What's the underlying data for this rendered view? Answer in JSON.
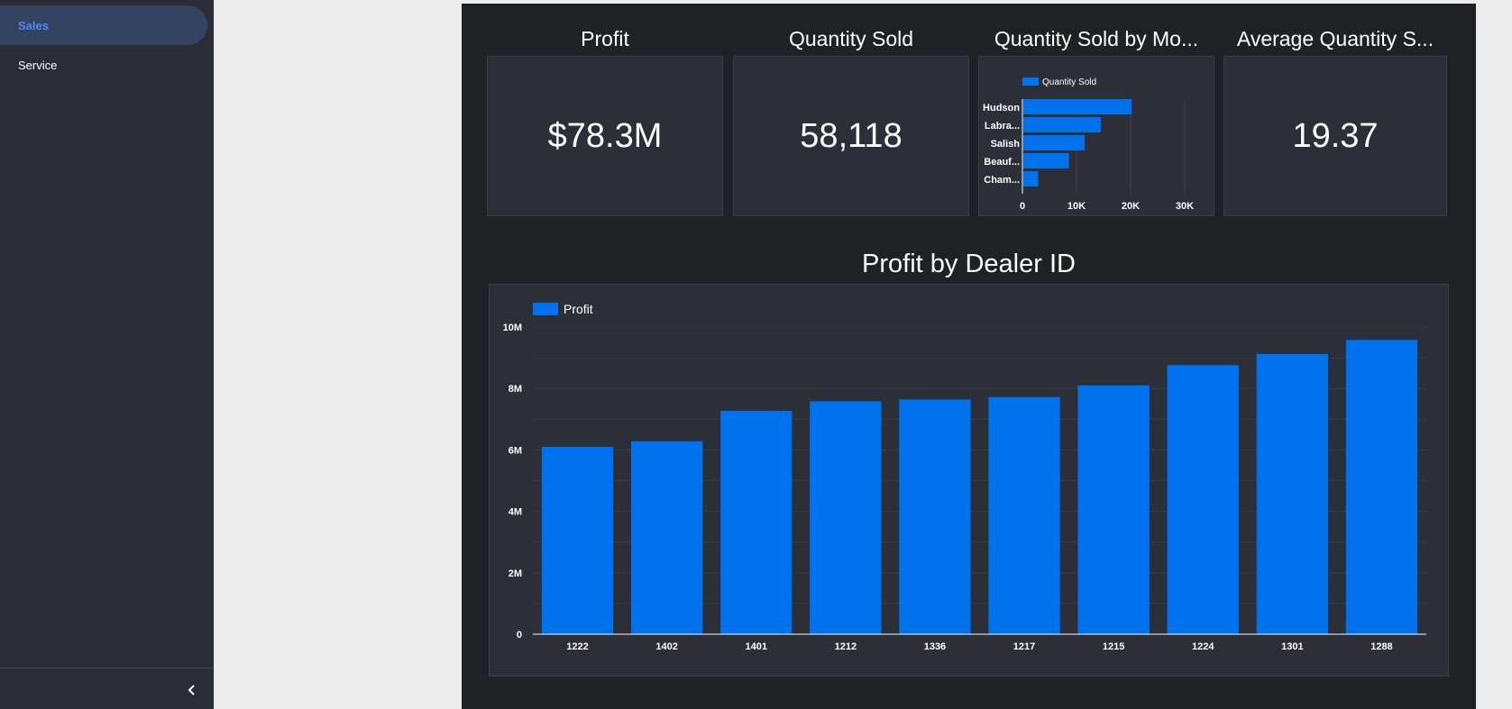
{
  "sidebar": {
    "items": [
      {
        "label": "Sales",
        "active": true
      },
      {
        "label": "Service",
        "active": false
      }
    ],
    "collapse_icon": "chevron-left-icon"
  },
  "theme": {
    "canvas_bg": "#202124",
    "card_bg": "#2d2f38",
    "bar_color": "#0072ee",
    "active_nav_color": "#4c8bf5"
  },
  "kpis": {
    "profit": {
      "title": "Profit",
      "value": "$78.3M"
    },
    "quantity_sold": {
      "title": "Quantity Sold",
      "value": "58,118"
    },
    "avg_quantity": {
      "title": "Average Quantity S...",
      "value": "19.37"
    }
  },
  "model_chart": {
    "title": "Quantity Sold by Mo...",
    "legend": "Quantity Sold",
    "categories": [
      "Hudson",
      "Labra...",
      "Salish",
      "Beauf...",
      "Cham..."
    ],
    "values": [
      20200,
      14500,
      11500,
      8600,
      2900
    ],
    "ticks": [
      {
        "v": 0,
        "label": "0"
      },
      {
        "v": 10000,
        "label": "10K"
      },
      {
        "v": 20000,
        "label": "20K"
      },
      {
        "v": 30000,
        "label": "30K"
      }
    ],
    "xlim": [
      0,
      32000
    ]
  },
  "dealer_chart": {
    "title": "Profit by Dealer ID",
    "legend": "Profit",
    "categories": [
      "1222",
      "1402",
      "1401",
      "1212",
      "1336",
      "1217",
      "1215",
      "1224",
      "1301",
      "1288"
    ],
    "values": [
      6100000,
      6280000,
      7270000,
      7580000,
      7640000,
      7720000,
      8100000,
      8760000,
      9120000,
      9580000
    ],
    "ticks": [
      {
        "v": 0,
        "label": "0"
      },
      {
        "v": 2000000,
        "label": "2M"
      },
      {
        "v": 4000000,
        "label": "4M"
      },
      {
        "v": 6000000,
        "label": "6M"
      },
      {
        "v": 8000000,
        "label": "8M"
      },
      {
        "v": 10000000,
        "label": "10M"
      }
    ],
    "ylim": [
      0,
      10000000
    ]
  },
  "chart_data": [
    {
      "type": "bar",
      "orientation": "horizontal",
      "title": "Quantity Sold by Mo...",
      "categories": [
        "Hudson",
        "Labra...",
        "Salish",
        "Beauf...",
        "Cham..."
      ],
      "series": [
        {
          "name": "Quantity Sold",
          "values": [
            20200,
            14500,
            11500,
            8600,
            2900
          ]
        }
      ],
      "xlim": [
        0,
        32000
      ],
      "grid": true,
      "legend": "top-left"
    },
    {
      "type": "bar",
      "title": "Profit by Dealer ID",
      "categories": [
        "1222",
        "1402",
        "1401",
        "1212",
        "1336",
        "1217",
        "1215",
        "1224",
        "1301",
        "1288"
      ],
      "series": [
        {
          "name": "Profit",
          "values": [
            6100000,
            6280000,
            7270000,
            7580000,
            7640000,
            7720000,
            8100000,
            8760000,
            9120000,
            9580000
          ]
        }
      ],
      "ylim": [
        0,
        10000000
      ],
      "grid": true,
      "legend": "top-left"
    }
  ]
}
